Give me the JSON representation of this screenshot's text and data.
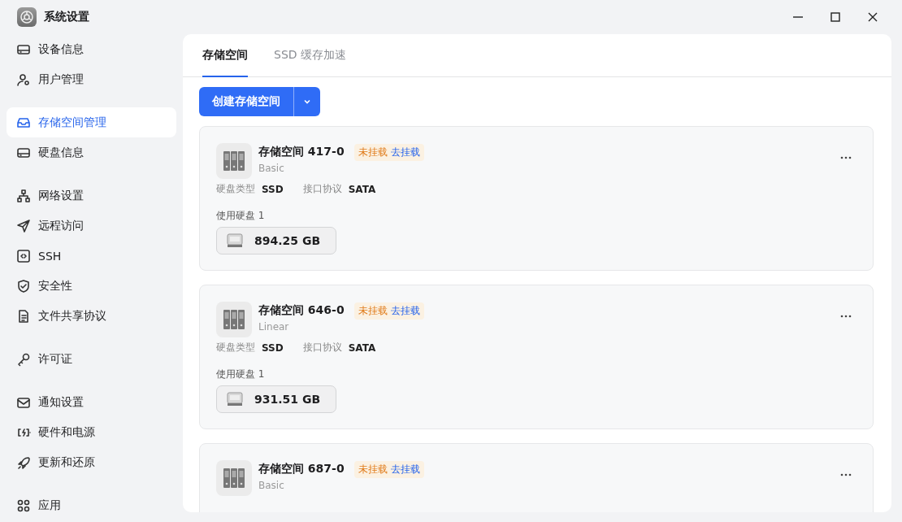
{
  "window": {
    "title": "系统设置"
  },
  "sidebar": {
    "groups": [
      [
        {
          "label": "设备信息",
          "selected": false
        },
        {
          "label": "用户管理",
          "selected": false
        }
      ],
      [
        {
          "label": "存储空间管理",
          "selected": true
        },
        {
          "label": "硬盘信息",
          "selected": false
        }
      ],
      [
        {
          "label": "网络设置",
          "selected": false
        },
        {
          "label": "远程访问",
          "selected": false
        },
        {
          "label": "SSH",
          "selected": false
        },
        {
          "label": "安全性",
          "selected": false
        },
        {
          "label": "文件共享协议",
          "selected": false
        }
      ],
      [
        {
          "label": "许可证",
          "selected": false
        }
      ],
      [
        {
          "label": "通知设置",
          "selected": false
        },
        {
          "label": "硬件和电源",
          "selected": false
        },
        {
          "label": "更新和还原",
          "selected": false
        }
      ],
      [
        {
          "label": "应用",
          "selected": false
        }
      ]
    ]
  },
  "tabs": [
    {
      "label": "存储空间",
      "selected": true
    },
    {
      "label": "SSD 缓存加速",
      "selected": false
    }
  ],
  "create_button": {
    "label": "创建存储空间"
  },
  "pools": [
    {
      "name": "存储空间 417-0",
      "status": "未挂载",
      "action": "去挂载",
      "type": "Basic",
      "disk_type_label": "硬盘类型",
      "disk_type": "SSD",
      "interface_label": "接口协议",
      "interface": "SATA",
      "disks_label": "使用硬盘 1",
      "disks": [
        "894.25 GB"
      ]
    },
    {
      "name": "存储空间 646-0",
      "status": "未挂载",
      "action": "去挂载",
      "type": "Linear",
      "disk_type_label": "硬盘类型",
      "disk_type": "SSD",
      "interface_label": "接口协议",
      "interface": "SATA",
      "disks_label": "使用硬盘 1",
      "disks": [
        "931.51 GB"
      ]
    },
    {
      "name": "存储空间 687-0",
      "status": "未挂载",
      "action": "去挂载",
      "type": "Basic"
    }
  ]
}
